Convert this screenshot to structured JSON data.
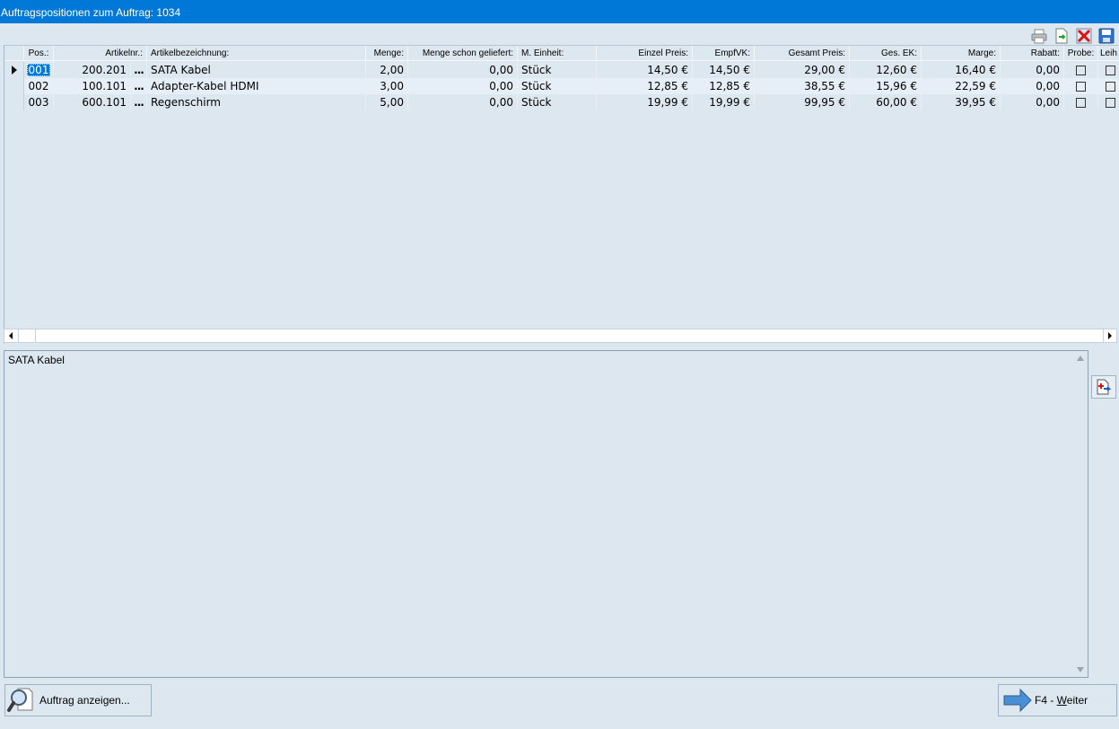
{
  "window": {
    "title": "Auftragspositionen zum Auftrag: 1034"
  },
  "toolbar": {
    "icons": [
      "printer-icon",
      "export-icon",
      "delete-icon",
      "save-icon"
    ]
  },
  "grid": {
    "columns": [
      "Pos.:",
      "Artikelnr.:",
      "Artikelbezeichnung:",
      "Menge:",
      "Menge schon geliefert:",
      "M. Einheit:",
      "Einzel Preis:",
      "EmpfVK:",
      "Gesamt Preis:",
      "Ges. EK:",
      "Marge:",
      "Rabatt:",
      "Probe:",
      "Leih"
    ],
    "rows": [
      {
        "pos": "001",
        "artikelnr": "200.201",
        "dots": "...",
        "bezeichnung": "SATA Kabel",
        "menge": "2,00",
        "geliefert": "0,00",
        "einheit": "Stück",
        "einzelpreis": "14,50 €",
        "empfvk": "14,50 €",
        "gesamtpreis": "29,00 €",
        "gesek": "12,60 €",
        "marge": "16,40 €",
        "rabatt": "0,00",
        "probe": false,
        "leih": false,
        "selected": true
      },
      {
        "pos": "002",
        "artikelnr": "100.101",
        "dots": "...",
        "bezeichnung": "Adapter-Kabel HDMI",
        "menge": "3,00",
        "geliefert": "0,00",
        "einheit": "Stück",
        "einzelpreis": "12,85 €",
        "empfvk": "12,85 €",
        "gesamtpreis": "38,55 €",
        "gesek": "15,96 €",
        "marge": "22,59 €",
        "rabatt": "0,00",
        "probe": false,
        "leih": false,
        "selected": false
      },
      {
        "pos": "003",
        "artikelnr": "600.101",
        "dots": "...",
        "bezeichnung": "Regenschirm",
        "menge": "5,00",
        "geliefert": "0,00",
        "einheit": "Stück",
        "einzelpreis": "19,99 €",
        "empfvk": "19,99 €",
        "gesamtpreis": "99,95 €",
        "gesek": "60,00 €",
        "marge": "39,95 €",
        "rabatt": "0,00",
        "probe": false,
        "leih": false,
        "selected": false
      }
    ]
  },
  "memo": {
    "text": "SATA Kabel"
  },
  "buttons": {
    "show_order": "Auftrag anzeigen...",
    "next_prefix": "F4 - ",
    "next_underlined": "W",
    "next_rest": "eiter"
  },
  "colors": {
    "titlebar": "#0078d7",
    "background": "#dde7f0",
    "selection": "#0078d7"
  }
}
